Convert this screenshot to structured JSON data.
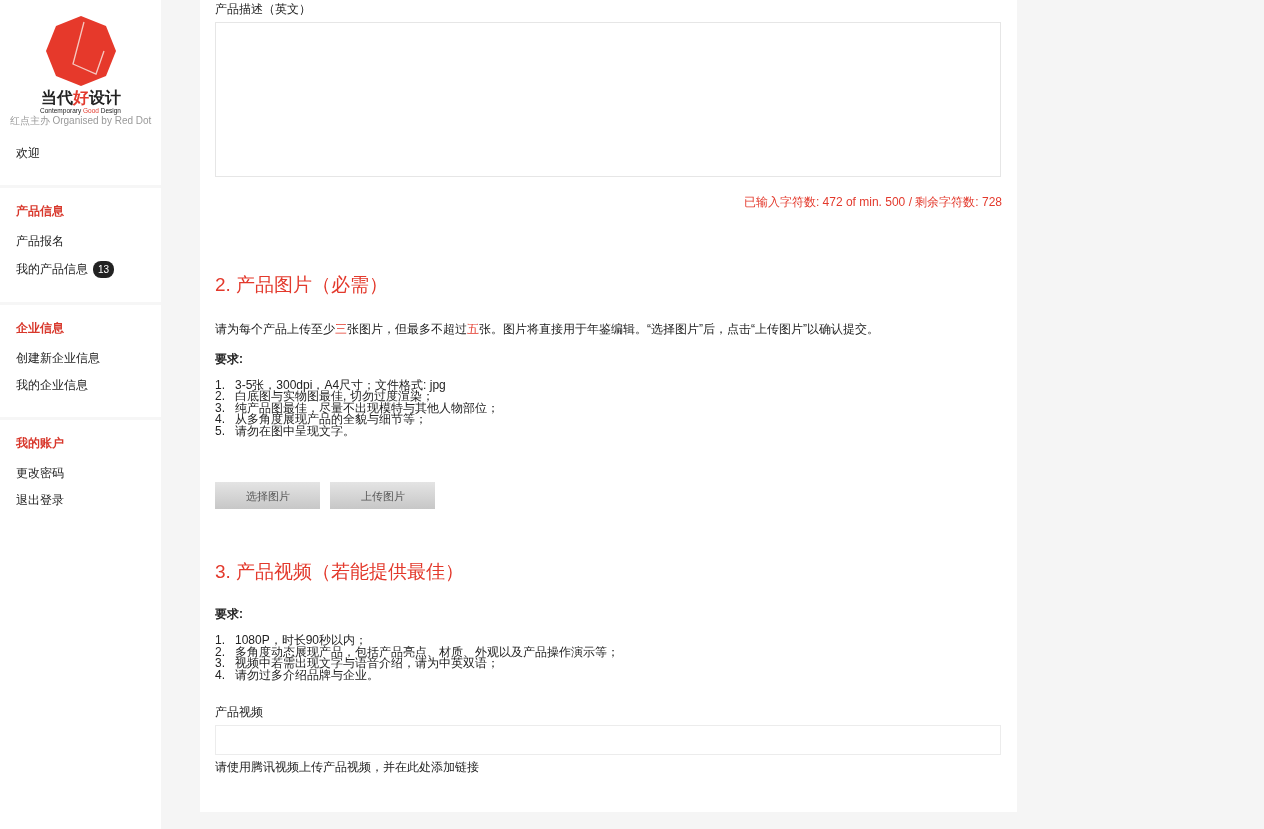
{
  "logo": {
    "name_parts": [
      {
        "text": "当代",
        "accent": false
      },
      {
        "text": "好",
        "accent": true
      },
      {
        "text": "设计",
        "accent": false
      }
    ],
    "tagline_parts": [
      {
        "text": "Contemporary ",
        "accent": false
      },
      {
        "text": "Good",
        "accent": true
      },
      {
        "text": " Design",
        "accent": false
      }
    ],
    "organiser": "红点主办 Organised by Red Dot"
  },
  "sidebar": {
    "groups": [
      {
        "items": [
          {
            "label": "欢迎"
          }
        ]
      },
      {
        "heading": "产品信息",
        "items": [
          {
            "label": "产品报名"
          },
          {
            "label": "我的产品信息",
            "badge": "13"
          }
        ]
      },
      {
        "heading": "企业信息",
        "items": [
          {
            "label": "创建新企业信息"
          },
          {
            "label": "我的企业信息"
          }
        ]
      },
      {
        "heading": "我的账户",
        "items": [
          {
            "label": "更改密码"
          },
          {
            "label": "退出登录"
          }
        ]
      }
    ]
  },
  "description_field": {
    "label": "产品描述（英文）",
    "counter": "已输入字符数:  472 of min. 500 / 剩余字符数:  728"
  },
  "images_section": {
    "title": "2. 产品图片（必需）",
    "intro_parts": [
      {
        "text": "请为每个产品上传至少",
        "accent": false
      },
      {
        "text": "三",
        "accent": true
      },
      {
        "text": "张图片，但最多不超过",
        "accent": false
      },
      {
        "text": "五",
        "accent": true
      },
      {
        "text": "张。图片将直接用于年鉴编辑。“选择图片”后，点击“上传图片”以确认提交。",
        "accent": false
      }
    ],
    "requirements_label": "要求:",
    "requirements": [
      {
        "number": "1.",
        "text": "3-5张，300dpi，A4尺寸；文件格式: jpg"
      },
      {
        "number": "2.",
        "text": "白底图与实物图最佳, 切勿过度渲染；"
      },
      {
        "number": "3.",
        "text": "纯产品图最佳，尽量不出现模特与其他人物部位；"
      },
      {
        "number": "4.",
        "text": "从多角度展现产品的全貌与细节等；"
      },
      {
        "number": "5.",
        "text": "请勿在图中呈现文字。"
      }
    ],
    "buttons": [
      "选择图片",
      "上传图片"
    ]
  },
  "video_section": {
    "title": "3. 产品视频（若能提供最佳）",
    "requirements_label": "要求:",
    "requirements": [
      {
        "number": "1.",
        "text": "1080P，时长90秒以内；"
      },
      {
        "number": "2.",
        "text": "多角度动态展现产品，包括产品亮点、材质、外观以及产品操作演示等；"
      },
      {
        "number": "3.",
        "text": "视频中若需出现文字与语音介绍，请为中英双语；"
      },
      {
        "number": "4.",
        "text": "请勿过多介绍品牌与企业。"
      }
    ],
    "field_label": "产品视频",
    "help": "请使用腾讯视频上传产品视频，并在此处添加链接"
  }
}
